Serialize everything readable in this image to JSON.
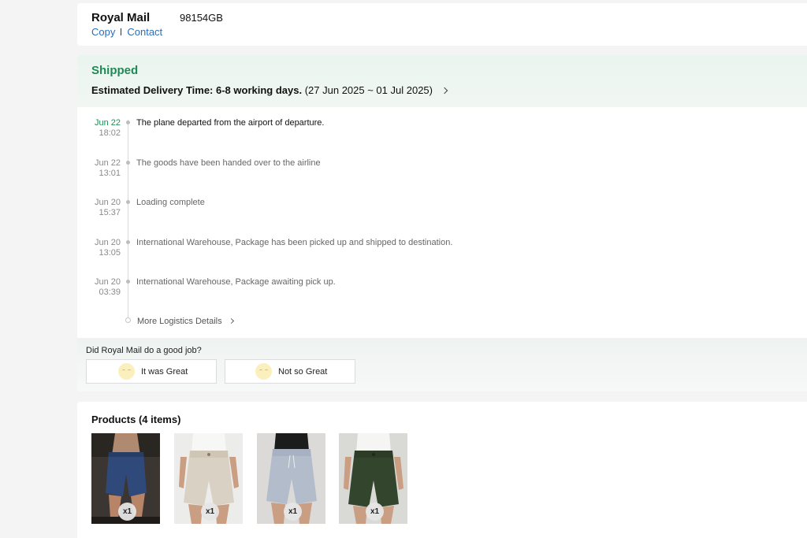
{
  "carrier": {
    "name": "Royal Mail",
    "tracking_number": "98154GB",
    "copy_label": "Copy",
    "contact_label": "Contact"
  },
  "status": {
    "title": "Shipped",
    "eta_label": "Estimated Delivery Time: 6-8 working days.",
    "eta_range": "(27 Jun 2025 ~ 01 Jul 2025)"
  },
  "timeline": [
    {
      "date": "Jun 22",
      "time": "18:02",
      "text": "The plane departed from the airport of departure."
    },
    {
      "date": "Jun 22",
      "time": "13:01",
      "text": "The goods have been handed over to the airline"
    },
    {
      "date": "Jun 20",
      "time": "15:37",
      "text": "Loading complete"
    },
    {
      "date": "Jun 20",
      "time": "13:05",
      "text": "International Warehouse, Package has been picked up and shipped to destination."
    },
    {
      "date": "Jun 20",
      "time": "03:39",
      "text": "International Warehouse, Package awaiting pick up."
    }
  ],
  "more_details_label": "More Logistics Details",
  "feedback": {
    "question": "Did Royal Mail do a good job?",
    "great_label": "It was Great",
    "bad_label": "Not so Great"
  },
  "products": {
    "title": "Products (4 items)",
    "items": [
      {
        "qty": "x1",
        "color": "navy"
      },
      {
        "qty": "x1",
        "color": "beige"
      },
      {
        "qty": "x1",
        "color": "light-blue"
      },
      {
        "qty": "x1",
        "color": "dark-green"
      }
    ]
  },
  "colors": {
    "accent_green": "#1f8a55",
    "link_blue": "#2d6db5"
  }
}
